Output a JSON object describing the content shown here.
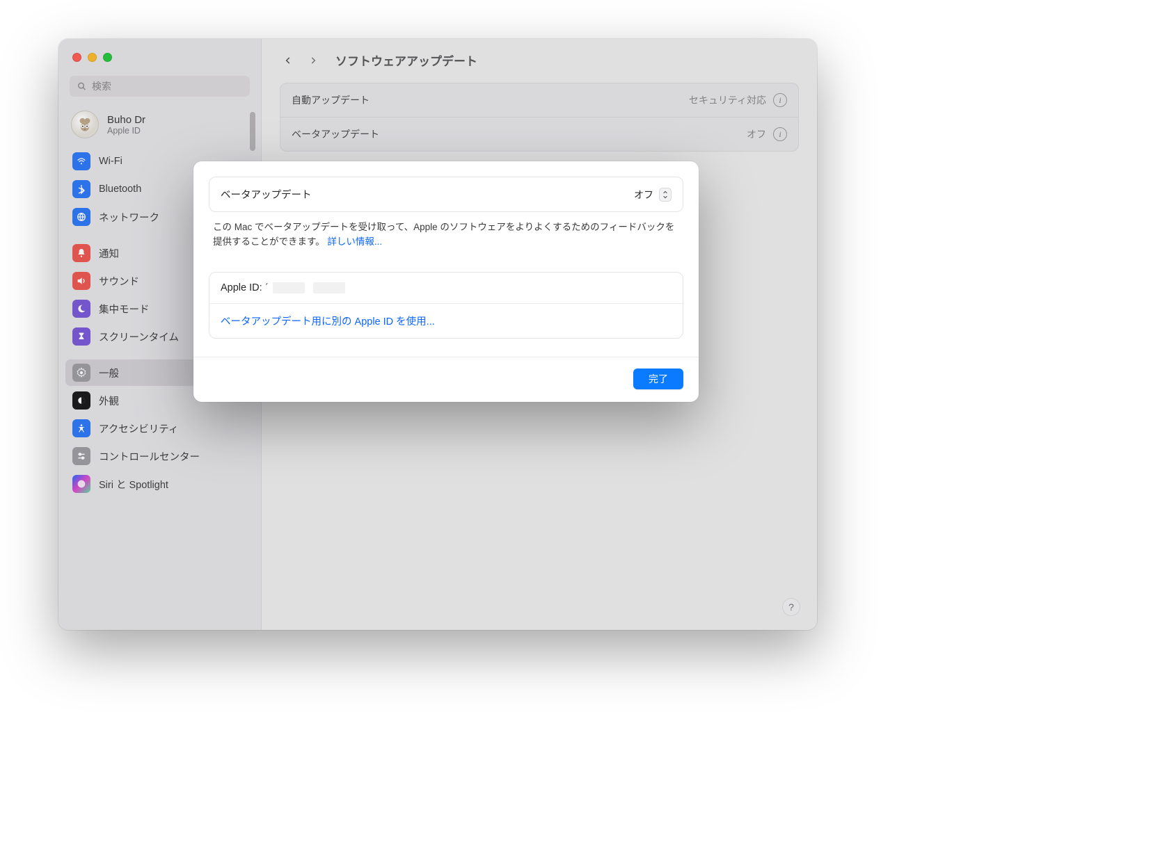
{
  "window": {
    "search_placeholder": "検索"
  },
  "account": {
    "name": "Buho Dr",
    "sub": "Apple ID"
  },
  "sidebar": {
    "items": [
      {
        "id": "wifi",
        "label": "Wi-Fi"
      },
      {
        "id": "bluetooth",
        "label": "Bluetooth"
      },
      {
        "id": "network",
        "label": "ネットワーク"
      },
      {
        "id": "notifications",
        "label": "通知"
      },
      {
        "id": "sound",
        "label": "サウンド"
      },
      {
        "id": "focus",
        "label": "集中モード"
      },
      {
        "id": "screentime",
        "label": "スクリーンタイム"
      },
      {
        "id": "general",
        "label": "一般"
      },
      {
        "id": "appearance",
        "label": "外観"
      },
      {
        "id": "accessibility",
        "label": "アクセシビリティ"
      },
      {
        "id": "control-center",
        "label": "コントロールセンター"
      },
      {
        "id": "siri",
        "label": "Siri と Spotlight"
      }
    ]
  },
  "header": {
    "title": "ソフトウェアアップデート"
  },
  "main": {
    "rows": [
      {
        "label": "自動アップデート",
        "value": "セキュリティ対応"
      },
      {
        "label": "ベータアップデート",
        "value": "オフ"
      }
    ]
  },
  "modal": {
    "beta_label": "ベータアップデート",
    "beta_value": "オフ",
    "description": "この Mac でベータアップデートを受け取って、Apple のソフトウェアをよりよくするためのフィードバックを提供することができます。",
    "more_info": "詳しい情報...",
    "apple_id_label": "Apple ID:",
    "use_other_id": "ベータアップデート用に別の Apple ID を使用...",
    "done": "完了"
  },
  "help": "?"
}
